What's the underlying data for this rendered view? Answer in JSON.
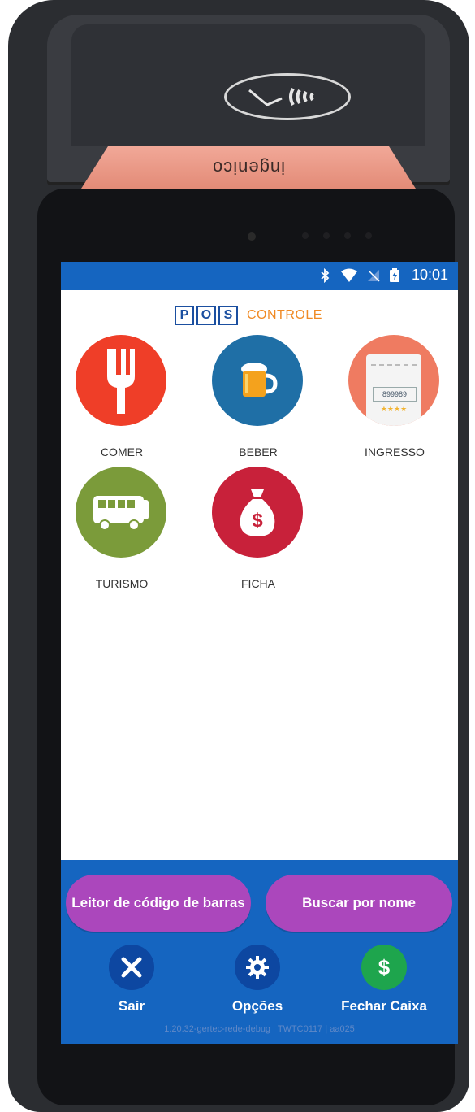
{
  "device": {
    "brand": "ingenico"
  },
  "status_bar": {
    "time": "10:01"
  },
  "logo": {
    "letters": [
      "P",
      "O",
      "S"
    ],
    "word": "CONTROLE"
  },
  "tiles": [
    {
      "label": "COMER",
      "icon": "fork-icon",
      "color": "#ef3e28"
    },
    {
      "label": "BEBER",
      "icon": "beer-mug-icon",
      "color": "#1f6fa6"
    },
    {
      "label": "INGRESSO",
      "icon": "ticket-icon",
      "color": "#ef7b61",
      "ticket_number": "899989"
    },
    {
      "label": "TURISMO",
      "icon": "bus-icon",
      "color": "#7b9b3a"
    },
    {
      "label": "FICHA",
      "icon": "money-bag-icon",
      "color": "#c8213a"
    }
  ],
  "buttons": {
    "barcode": "Leitor de código de barras",
    "search_name": "Buscar por nome"
  },
  "actions": [
    {
      "label": "Sair",
      "icon": "close-icon"
    },
    {
      "label": "Opções",
      "icon": "gear-icon"
    },
    {
      "label": "Fechar Caixa",
      "icon": "dollar-icon"
    }
  ],
  "version": "1.20.32-gertec-rede-debug | TWTC0117 | aa025",
  "colors": {
    "primary": "#1565c0",
    "accent_button": "#ab47bc",
    "logo_blue": "#1b4fa0",
    "logo_orange": "#f08a24"
  }
}
